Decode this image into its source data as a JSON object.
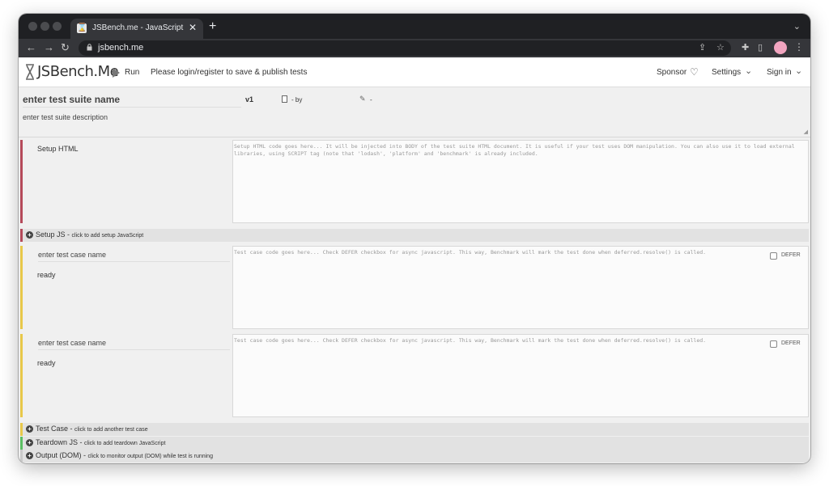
{
  "browser": {
    "tab_title": "JSBench.me - JavaScript perfo",
    "url": "jsbench.me"
  },
  "header": {
    "logo": "JSBench.Me",
    "run_label": "Run",
    "login_message": "Please login/register to save & publish tests",
    "sponsor_label": "Sponsor",
    "settings_label": "Settings",
    "signin_label": "Sign in"
  },
  "suite": {
    "name_placeholder": "enter test suite name",
    "version": "v1",
    "by_text": "- by",
    "edit_text": "-",
    "description_placeholder": "enter test suite description"
  },
  "setup_html": {
    "label": "Setup HTML",
    "placeholder": "Setup HTML code goes here... It will be injected into BODY of the test suite HTML document. It is useful if your test uses DOM manipulation. You can also use it to load external libraries, using SCRIPT tag (note that 'lodash', 'platform' and 'benchmark' is already included."
  },
  "setup_js": {
    "title": "Setup JS",
    "hint": "click to add setup JavaScript"
  },
  "test_cases": [
    {
      "name_placeholder": "enter test case name",
      "status": "ready",
      "code_placeholder": "Test case code goes here... Check DEFER checkbox for async javascript. This way, Benchmark will mark the test done when deferred.resolve() is called.",
      "defer_label": "DEFER"
    },
    {
      "name_placeholder": "enter test case name",
      "status": "ready",
      "code_placeholder": "Test case code goes here... Check DEFER checkbox for async javascript. This way, Benchmark will mark the test done when deferred.resolve() is called.",
      "defer_label": "DEFER"
    }
  ],
  "add_test_case": {
    "title": "Test Case",
    "hint": "click to add another test case"
  },
  "teardown_js": {
    "title": "Teardown JS",
    "hint": "click to add teardown JavaScript"
  },
  "output_dom": {
    "title": "Output (DOM)",
    "hint": "click to monitor output (DOM) while test is running"
  },
  "colors": {
    "setup_accent": "#b54a5a",
    "case_accent": "#e8c84a",
    "teardown_accent": "#5bbf63",
    "output_accent": "#c9c9c9"
  }
}
